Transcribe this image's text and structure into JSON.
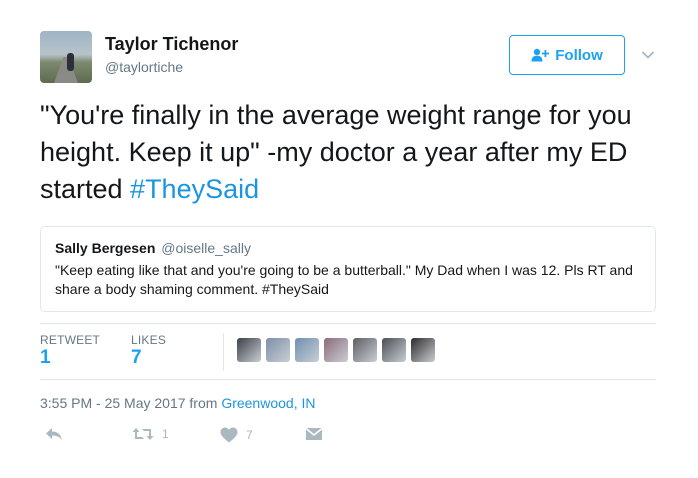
{
  "author": {
    "name": "Taylor Tichenor",
    "handle": "@taylortiche"
  },
  "follow_button": {
    "label": "Follow",
    "icon": "add-person-icon"
  },
  "tweet": {
    "text": "\"You're finally in the average weight range for you height. Keep it up\" -my doctor a year after my ED started ",
    "hashtag": "#TheySaid"
  },
  "quoted_tweet": {
    "name": "Sally Bergesen",
    "handle": "@oiselle_sally",
    "text": "\"Keep eating like that and you're going to be a butterball.\" My Dad when I was 12. Pls RT and share a body shaming comment. #TheySaid"
  },
  "stats": {
    "retweets_label": "RETWEET",
    "retweets_count": "1",
    "likes_label": "LIKES",
    "likes_count": "7"
  },
  "likers": [
    {
      "color": "#3b3f46"
    },
    {
      "color": "#7d8fa8"
    },
    {
      "color": "#6f8fb0"
    },
    {
      "color": "#8b6b7a"
    },
    {
      "color": "#5b5f64"
    },
    {
      "color": "#4a4f56"
    },
    {
      "color": "#2e2a2c"
    }
  ],
  "meta": {
    "timestamp": "3:55 PM - 25 May 2017 from ",
    "location": "Greenwood, IN"
  },
  "actions": {
    "reply_icon": "reply-icon",
    "retweet_icon": "retweet-icon",
    "retweet_count": "1",
    "like_icon": "heart-icon",
    "like_count": "7",
    "dm_icon": "envelope-icon"
  },
  "colors": {
    "accent": "#1da1f2",
    "link": "#1b95e0",
    "muted": "#657786"
  }
}
